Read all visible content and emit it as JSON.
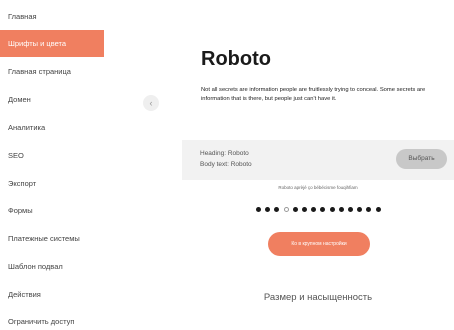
{
  "sidebar": {
    "items": [
      {
        "label": "Главная",
        "active": false
      },
      {
        "label": "Шрифты и цвета",
        "active": true
      },
      {
        "label": "Главная страница",
        "active": false
      },
      {
        "label": "Домен",
        "active": false
      },
      {
        "label": "Аналитика",
        "active": false
      },
      {
        "label": "SEO",
        "active": false
      },
      {
        "label": "Экспорт",
        "active": false
      },
      {
        "label": "Формы",
        "active": false
      },
      {
        "label": "Платежные системы",
        "active": false
      },
      {
        "label": "Шаблон подвал",
        "active": false
      },
      {
        "label": "Действия",
        "active": false
      },
      {
        "label": "Ограничить доступ",
        "active": false
      }
    ],
    "collapse_icon": "chevron-left-icon"
  },
  "preview": {
    "font_name": "Roboto",
    "description": "Not all secrets are information people are fruitlessly trying to conceal. Some secrets are information that is there, but people just can't have it."
  },
  "font_settings": {
    "heading_line": "Heading: Roboto",
    "body_line": "Body text: Roboto",
    "select_label": "Выбрать"
  },
  "sample": {
    "text": "Roboto aprèjé ço bébécisme fouqihfiam"
  },
  "pagination": {
    "total": 14,
    "current": 4
  },
  "apply_button": {
    "label": "Ко в крупном настройки"
  },
  "section": {
    "heading": "Размер и насыщенность"
  },
  "colors": {
    "accent": "#f07f60",
    "panel_gray": "#f2f2f2",
    "button_gray": "#c8c8c8"
  }
}
